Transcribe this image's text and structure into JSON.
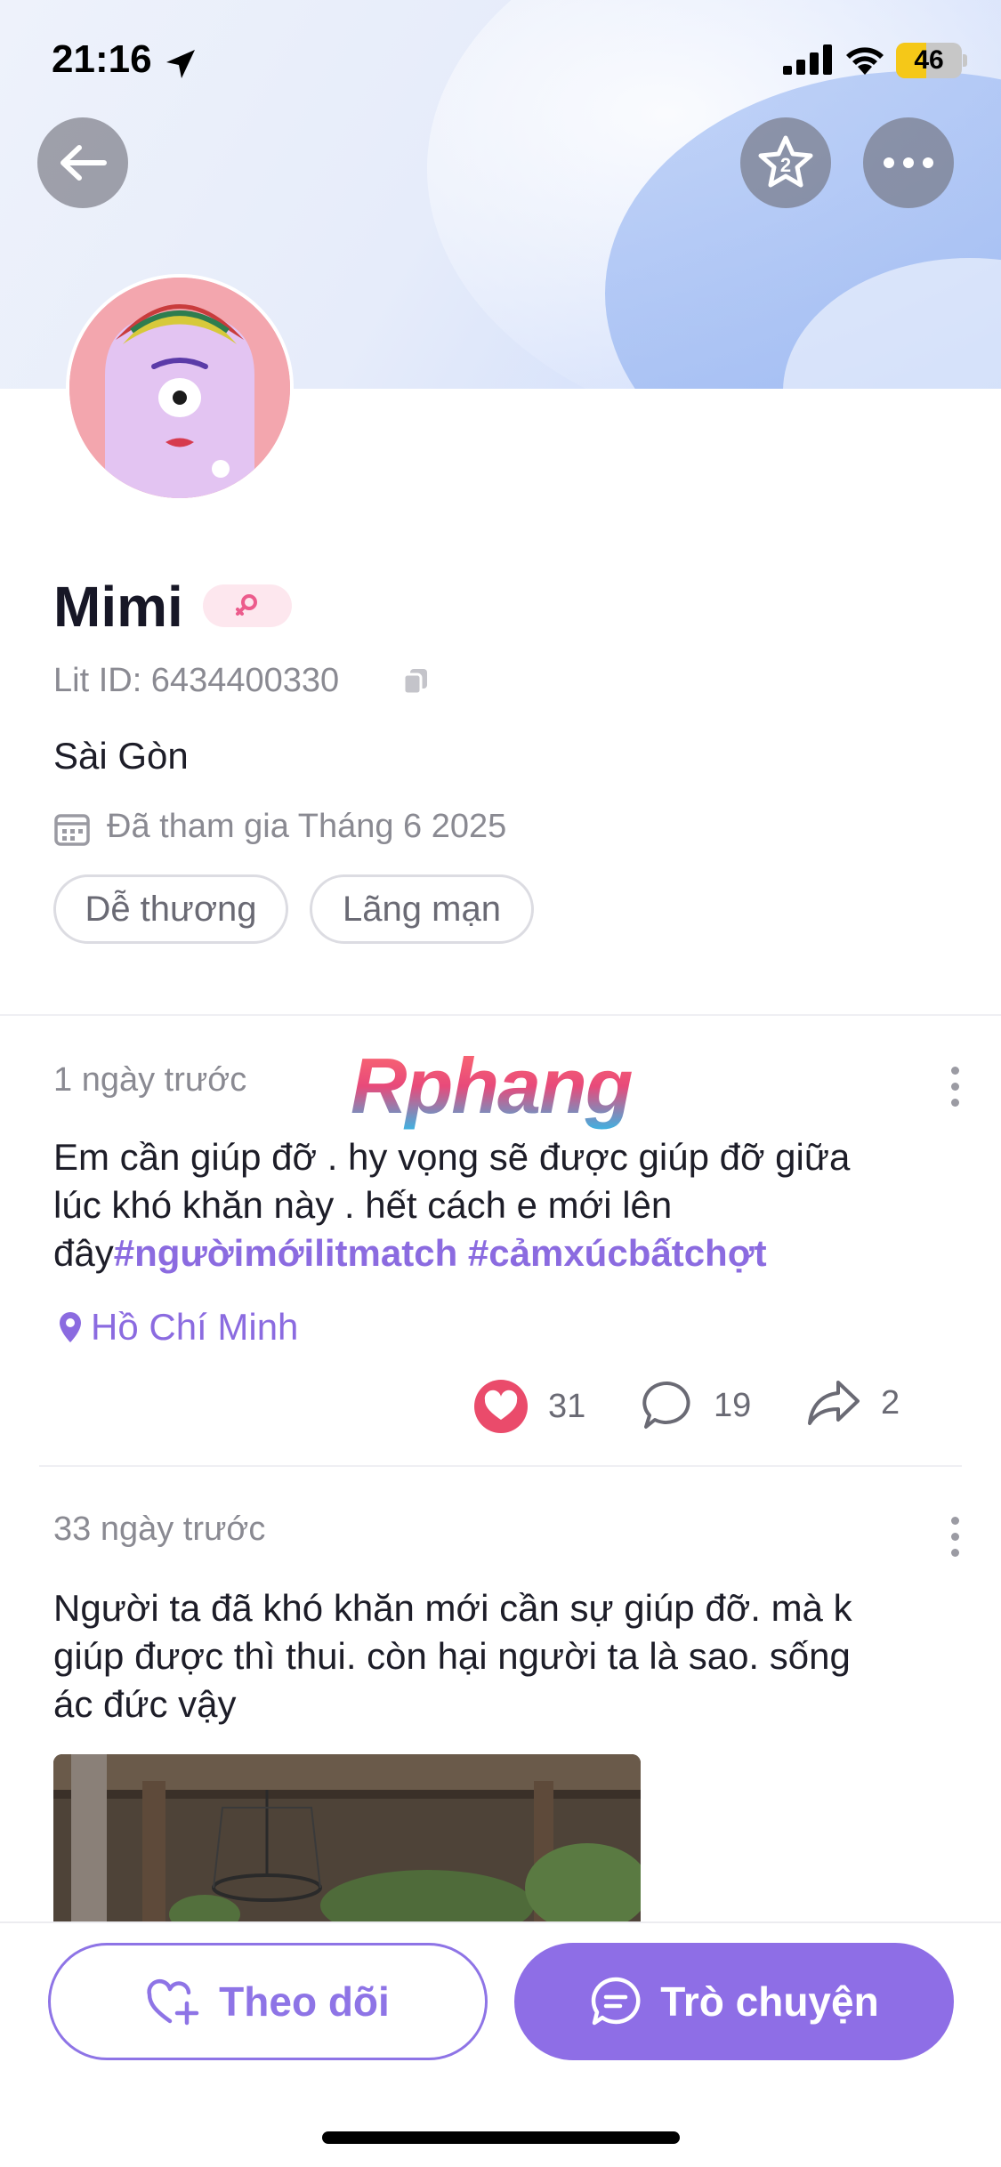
{
  "status_bar": {
    "time": "21:16",
    "battery": "46",
    "battery_level": 0.46,
    "icons": [
      "location-arrow-icon",
      "signal-bars-icon",
      "wifi-icon",
      "battery-icon"
    ]
  },
  "header": {
    "buttons": [
      "back-arrow-icon",
      "star-badge-icon",
      "more-dots-icon"
    ],
    "star_badge_number": "2"
  },
  "profile": {
    "name": "Mimi",
    "gender_icon": "female-icon",
    "lit_id": "Lit ID: 6434400330",
    "location": "Sài Gòn",
    "joined": "Đã tham gia Tháng 6 2025",
    "tags": [
      "Dễ thương",
      "Lãng mạn"
    ]
  },
  "watermark": "Rphang",
  "posts": [
    {
      "time": "1 ngày trước",
      "text_line1": "Em cần giúp đỡ  . hy vọng sẽ được giúp đỡ giữa",
      "text_line2": "lúc khó khăn này . hết cách e mới lên",
      "text_line3_plain": "đây",
      "hashtags": "#ngườimớilitmatch #cảmxúcbấtchợt",
      "location": "Hồ Chí Minh",
      "likes": "31",
      "comments": "19",
      "shares": "2"
    },
    {
      "time": "33 ngày trước",
      "text_line1": "Người ta đã khó khăn mới cần sự giúp đỡ. mà k",
      "text_line2": "giúp được thì thui. còn hại người ta là sao. sống",
      "text_line3": "ác đức vậy"
    }
  ],
  "actions": {
    "follow_label": "Theo dõi",
    "chat_label": "Trò chuyện"
  },
  "colors": {
    "accent": "#8e6ee6",
    "hashtag": "#8b6be0",
    "like": "#ea4b6b"
  }
}
